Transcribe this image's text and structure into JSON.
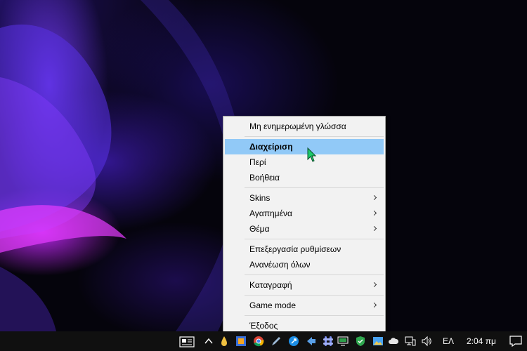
{
  "menu": {
    "items": [
      {
        "label": "Μη ενημερωμένη γλώσσα"
      },
      {
        "label": "Διαχείριση"
      },
      {
        "label": "Περί"
      },
      {
        "label": "Βοήθεια"
      },
      {
        "label": "Skins"
      },
      {
        "label": "Αγαπημένα"
      },
      {
        "label": "Θέμα"
      },
      {
        "label": "Επεξεργασία ρυθμίσεων"
      },
      {
        "label": "Ανανέωση όλων"
      },
      {
        "label": "Καταγραφή"
      },
      {
        "label": "Game mode"
      },
      {
        "label": "Έξοδος"
      }
    ]
  },
  "taskbar": {
    "language": "ΕΛ",
    "time": "2:04 πμ",
    "icons": [
      "news-widget-icon",
      "chevron-up-icon",
      "droplet-icon",
      "grid-app-icon",
      "chrome-icon",
      "pen-icon",
      "feather-icon",
      "arrow-app-icon",
      "slack-icon",
      "film-icon",
      "monitor-icon",
      "shield-check-icon",
      "photos-icon",
      "cloud-icon",
      "network-icon",
      "volume-icon",
      "notification-icon"
    ]
  },
  "colors": {
    "menu_bg": "#f2f2f2",
    "highlight": "#91c9f7",
    "taskbar": "#101010",
    "cursor": "#1ec96a"
  }
}
